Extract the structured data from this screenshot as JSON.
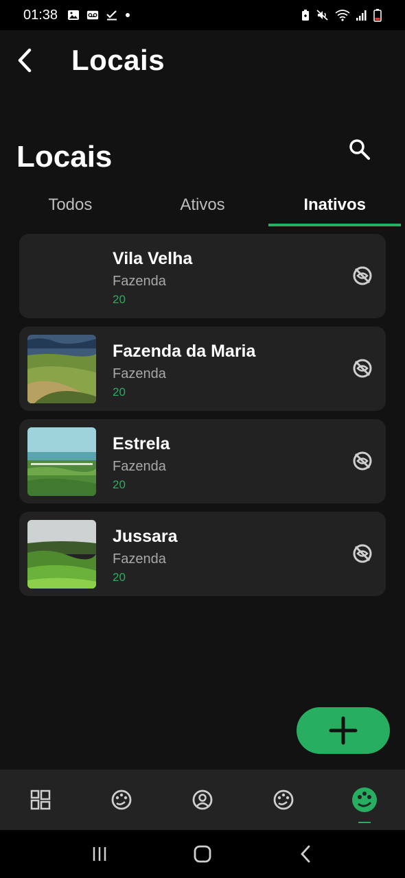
{
  "status_bar": {
    "time": "01:38"
  },
  "app_bar": {
    "title": "Locais"
  },
  "section": {
    "title": "Locais"
  },
  "tabs": [
    {
      "label": "Todos",
      "active": false
    },
    {
      "label": "Ativos",
      "active": false
    },
    {
      "label": "Inativos",
      "active": true
    }
  ],
  "places": [
    {
      "name": "Vila Velha",
      "type": "Fazenda",
      "count": "20",
      "has_image": false,
      "action_icon": "visibility-off-icon"
    },
    {
      "name": "Fazenda da Maria",
      "type": "Fazenda",
      "count": "20",
      "has_image": true,
      "action_icon": "visibility-off-icon"
    },
    {
      "name": "Estrela",
      "type": "Fazenda",
      "count": "20",
      "has_image": true,
      "action_icon": "visibility-off-icon"
    },
    {
      "name": "Jussara",
      "type": "Fazenda",
      "count": "20",
      "has_image": true,
      "action_icon": "visibility-off-icon"
    }
  ],
  "fab": {
    "icon": "plus-icon"
  },
  "bottom_nav": [
    {
      "icon": "dashboard-icon",
      "active": false
    },
    {
      "icon": "palette-icon",
      "active": false
    },
    {
      "icon": "account-circle-icon",
      "active": false
    },
    {
      "icon": "palette-icon",
      "active": false
    },
    {
      "icon": "eco-palette-icon",
      "active": true
    }
  ],
  "colors": {
    "accent": "#27ae60",
    "background": "#121212",
    "card": "#222222",
    "nav": "#232323"
  }
}
